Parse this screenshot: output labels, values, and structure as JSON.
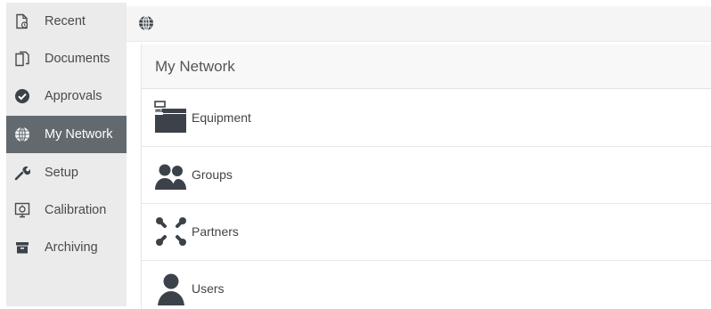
{
  "sidebar": {
    "items": [
      {
        "label": "Recent",
        "icon": "recent-file-icon"
      },
      {
        "label": "Documents",
        "icon": "documents-icon"
      },
      {
        "label": "Approvals",
        "icon": "check-circle-icon"
      },
      {
        "label": "My Network",
        "icon": "globe-icon",
        "active": true
      },
      {
        "label": "Setup",
        "icon": "wrench-icon"
      },
      {
        "label": "Calibration",
        "icon": "calibration-icon"
      },
      {
        "label": "Archiving",
        "icon": "archive-icon"
      }
    ]
  },
  "topbar": {
    "icon": "globe-icon"
  },
  "main": {
    "title": "My Network",
    "rows": [
      {
        "label": "Equipment",
        "icon": "equipment-icon"
      },
      {
        "label": "Groups",
        "icon": "groups-icon"
      },
      {
        "label": "Partners",
        "icon": "partners-icon"
      },
      {
        "label": "Users",
        "icon": "user-icon"
      }
    ]
  },
  "colors": {
    "sidebar_bg": "#ebebeb",
    "active_bg": "#626a70",
    "icon_dark": "#3c4249",
    "topbar_bg": "#f5f5f5"
  }
}
